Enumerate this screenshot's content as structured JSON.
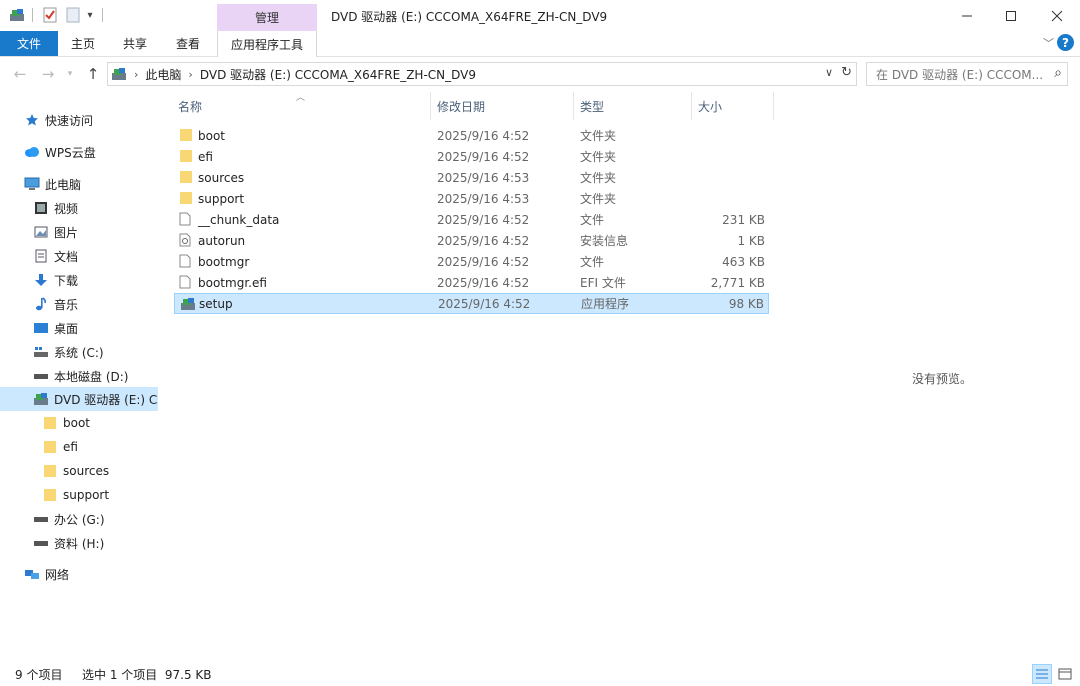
{
  "window": {
    "title": "DVD 驱动器 (E:) CCCOMA_X64FRE_ZH-CN_DV9",
    "context_tab_header": "管理"
  },
  "ribbon": {
    "tabs": [
      "文件",
      "主页",
      "共享",
      "查看"
    ],
    "context_tab": "应用程序工具"
  },
  "address": {
    "segments": [
      "此电脑",
      "DVD 驱动器 (E:) CCCOMA_X64FRE_ZH-CN_DV9"
    ],
    "search_placeholder": "在 DVD 驱动器 (E:) CCCOM..."
  },
  "sidebar": {
    "items": [
      {
        "label": "快速访问",
        "icon": "star-icon"
      },
      {
        "label": "WPS云盘",
        "icon": "cloud-icon"
      },
      {
        "label": "此电脑",
        "icon": "computer-icon"
      },
      {
        "label": "视频",
        "icon": "video-icon"
      },
      {
        "label": "图片",
        "icon": "picture-icon"
      },
      {
        "label": "文档",
        "icon": "document-icon"
      },
      {
        "label": "下载",
        "icon": "download-icon"
      },
      {
        "label": "音乐",
        "icon": "music-icon"
      },
      {
        "label": "桌面",
        "icon": "desktop-icon"
      },
      {
        "label": "系统 (C:)",
        "icon": "system-drive-icon"
      },
      {
        "label": "本地磁盘 (D:)",
        "icon": "drive-icon"
      },
      {
        "label": "DVD 驱动器 (E:) CCCOMA_X64FRE_ZH-CN_DV9",
        "icon": "dvd-drive-icon"
      },
      {
        "label": "boot",
        "icon": "folder-icon"
      },
      {
        "label": "efi",
        "icon": "folder-icon"
      },
      {
        "label": "sources",
        "icon": "folder-icon"
      },
      {
        "label": "support",
        "icon": "folder-icon"
      },
      {
        "label": "办公 (G:)",
        "icon": "drive-icon"
      },
      {
        "label": "资料 (H:)",
        "icon": "drive-icon"
      },
      {
        "label": "网络",
        "icon": "network-icon"
      }
    ]
  },
  "filelist": {
    "columns": [
      "名称",
      "修改日期",
      "类型",
      "大小"
    ],
    "rows": [
      {
        "name": "boot",
        "date": "2025/9/16 4:52",
        "type": "文件夹",
        "size": "",
        "icon": "folder-icon"
      },
      {
        "name": "efi",
        "date": "2025/9/16 4:52",
        "type": "文件夹",
        "size": "",
        "icon": "folder-icon"
      },
      {
        "name": "sources",
        "date": "2025/9/16 4:53",
        "type": "文件夹",
        "size": "",
        "icon": "folder-icon"
      },
      {
        "name": "support",
        "date": "2025/9/16 4:53",
        "type": "文件夹",
        "size": "",
        "icon": "folder-icon"
      },
      {
        "name": "__chunk_data",
        "date": "2025/9/16 4:52",
        "type": "文件",
        "size": "231 KB",
        "icon": "file-icon"
      },
      {
        "name": "autorun",
        "date": "2025/9/16 4:52",
        "type": "安装信息",
        "size": "1 KB",
        "icon": "setup-info-icon"
      },
      {
        "name": "bootmgr",
        "date": "2025/9/16 4:52",
        "type": "文件",
        "size": "463 KB",
        "icon": "file-icon"
      },
      {
        "name": "bootmgr.efi",
        "date": "2025/9/16 4:52",
        "type": "EFI 文件",
        "size": "2,771 KB",
        "icon": "file-icon"
      },
      {
        "name": "setup",
        "date": "2025/9/16 4:52",
        "type": "应用程序",
        "size": "98 KB",
        "icon": "setup-app-icon"
      }
    ]
  },
  "preview": {
    "message": "没有预览。"
  },
  "status": {
    "count": "9 个项目",
    "selection": "选中 1 个项目  97.5 KB"
  }
}
